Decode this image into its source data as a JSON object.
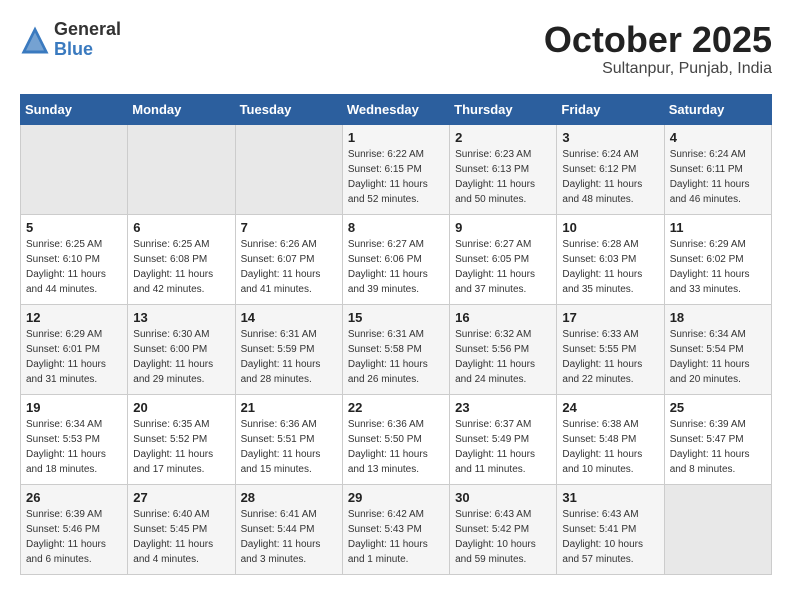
{
  "header": {
    "logo_general": "General",
    "logo_blue": "Blue",
    "month_title": "October 2025",
    "location": "Sultanpur, Punjab, India"
  },
  "days_of_week": [
    "Sunday",
    "Monday",
    "Tuesday",
    "Wednesday",
    "Thursday",
    "Friday",
    "Saturday"
  ],
  "weeks": [
    [
      {
        "day": "",
        "info": ""
      },
      {
        "day": "",
        "info": ""
      },
      {
        "day": "",
        "info": ""
      },
      {
        "day": "1",
        "info": "Sunrise: 6:22 AM\nSunset: 6:15 PM\nDaylight: 11 hours\nand 52 minutes."
      },
      {
        "day": "2",
        "info": "Sunrise: 6:23 AM\nSunset: 6:13 PM\nDaylight: 11 hours\nand 50 minutes."
      },
      {
        "day": "3",
        "info": "Sunrise: 6:24 AM\nSunset: 6:12 PM\nDaylight: 11 hours\nand 48 minutes."
      },
      {
        "day": "4",
        "info": "Sunrise: 6:24 AM\nSunset: 6:11 PM\nDaylight: 11 hours\nand 46 minutes."
      }
    ],
    [
      {
        "day": "5",
        "info": "Sunrise: 6:25 AM\nSunset: 6:10 PM\nDaylight: 11 hours\nand 44 minutes."
      },
      {
        "day": "6",
        "info": "Sunrise: 6:25 AM\nSunset: 6:08 PM\nDaylight: 11 hours\nand 42 minutes."
      },
      {
        "day": "7",
        "info": "Sunrise: 6:26 AM\nSunset: 6:07 PM\nDaylight: 11 hours\nand 41 minutes."
      },
      {
        "day": "8",
        "info": "Sunrise: 6:27 AM\nSunset: 6:06 PM\nDaylight: 11 hours\nand 39 minutes."
      },
      {
        "day": "9",
        "info": "Sunrise: 6:27 AM\nSunset: 6:05 PM\nDaylight: 11 hours\nand 37 minutes."
      },
      {
        "day": "10",
        "info": "Sunrise: 6:28 AM\nSunset: 6:03 PM\nDaylight: 11 hours\nand 35 minutes."
      },
      {
        "day": "11",
        "info": "Sunrise: 6:29 AM\nSunset: 6:02 PM\nDaylight: 11 hours\nand 33 minutes."
      }
    ],
    [
      {
        "day": "12",
        "info": "Sunrise: 6:29 AM\nSunset: 6:01 PM\nDaylight: 11 hours\nand 31 minutes."
      },
      {
        "day": "13",
        "info": "Sunrise: 6:30 AM\nSunset: 6:00 PM\nDaylight: 11 hours\nand 29 minutes."
      },
      {
        "day": "14",
        "info": "Sunrise: 6:31 AM\nSunset: 5:59 PM\nDaylight: 11 hours\nand 28 minutes."
      },
      {
        "day": "15",
        "info": "Sunrise: 6:31 AM\nSunset: 5:58 PM\nDaylight: 11 hours\nand 26 minutes."
      },
      {
        "day": "16",
        "info": "Sunrise: 6:32 AM\nSunset: 5:56 PM\nDaylight: 11 hours\nand 24 minutes."
      },
      {
        "day": "17",
        "info": "Sunrise: 6:33 AM\nSunset: 5:55 PM\nDaylight: 11 hours\nand 22 minutes."
      },
      {
        "day": "18",
        "info": "Sunrise: 6:34 AM\nSunset: 5:54 PM\nDaylight: 11 hours\nand 20 minutes."
      }
    ],
    [
      {
        "day": "19",
        "info": "Sunrise: 6:34 AM\nSunset: 5:53 PM\nDaylight: 11 hours\nand 18 minutes."
      },
      {
        "day": "20",
        "info": "Sunrise: 6:35 AM\nSunset: 5:52 PM\nDaylight: 11 hours\nand 17 minutes."
      },
      {
        "day": "21",
        "info": "Sunrise: 6:36 AM\nSunset: 5:51 PM\nDaylight: 11 hours\nand 15 minutes."
      },
      {
        "day": "22",
        "info": "Sunrise: 6:36 AM\nSunset: 5:50 PM\nDaylight: 11 hours\nand 13 minutes."
      },
      {
        "day": "23",
        "info": "Sunrise: 6:37 AM\nSunset: 5:49 PM\nDaylight: 11 hours\nand 11 minutes."
      },
      {
        "day": "24",
        "info": "Sunrise: 6:38 AM\nSunset: 5:48 PM\nDaylight: 11 hours\nand 10 minutes."
      },
      {
        "day": "25",
        "info": "Sunrise: 6:39 AM\nSunset: 5:47 PM\nDaylight: 11 hours\nand 8 minutes."
      }
    ],
    [
      {
        "day": "26",
        "info": "Sunrise: 6:39 AM\nSunset: 5:46 PM\nDaylight: 11 hours\nand 6 minutes."
      },
      {
        "day": "27",
        "info": "Sunrise: 6:40 AM\nSunset: 5:45 PM\nDaylight: 11 hours\nand 4 minutes."
      },
      {
        "day": "28",
        "info": "Sunrise: 6:41 AM\nSunset: 5:44 PM\nDaylight: 11 hours\nand 3 minutes."
      },
      {
        "day": "29",
        "info": "Sunrise: 6:42 AM\nSunset: 5:43 PM\nDaylight: 11 hours\nand 1 minute."
      },
      {
        "day": "30",
        "info": "Sunrise: 6:43 AM\nSunset: 5:42 PM\nDaylight: 10 hours\nand 59 minutes."
      },
      {
        "day": "31",
        "info": "Sunrise: 6:43 AM\nSunset: 5:41 PM\nDaylight: 10 hours\nand 57 minutes."
      },
      {
        "day": "",
        "info": ""
      }
    ]
  ]
}
